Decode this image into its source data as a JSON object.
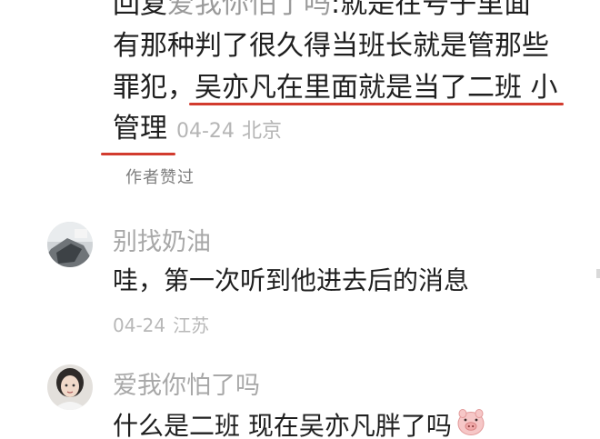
{
  "reply": {
    "line1": "回复",
    "line1_mention": "爱我你怕了吗",
    "line1_rest": ":就是在号子里面",
    "line2": "有那种判了很久得当班长就是管那些",
    "line3_prefix": "罪犯，",
    "line3_highlight": "吴亦凡在里面就是当了二班 小",
    "line4": "管理",
    "date": "04-24",
    "location": "北京",
    "author_liked": "作者赞过"
  },
  "comments": [
    {
      "username": "别找奶油",
      "text": "哇，第一次听到他进去后的消息",
      "date": "04-24",
      "location": "江苏"
    },
    {
      "username": "爱我你怕了吗",
      "text": "什么是二班  现在吴亦凡胖了吗",
      "emoji": "pig-face-emoji"
    }
  ],
  "colors": {
    "underline": "#d23b2e",
    "username": "#a8a8a8",
    "meta": "#b8b8b8"
  }
}
